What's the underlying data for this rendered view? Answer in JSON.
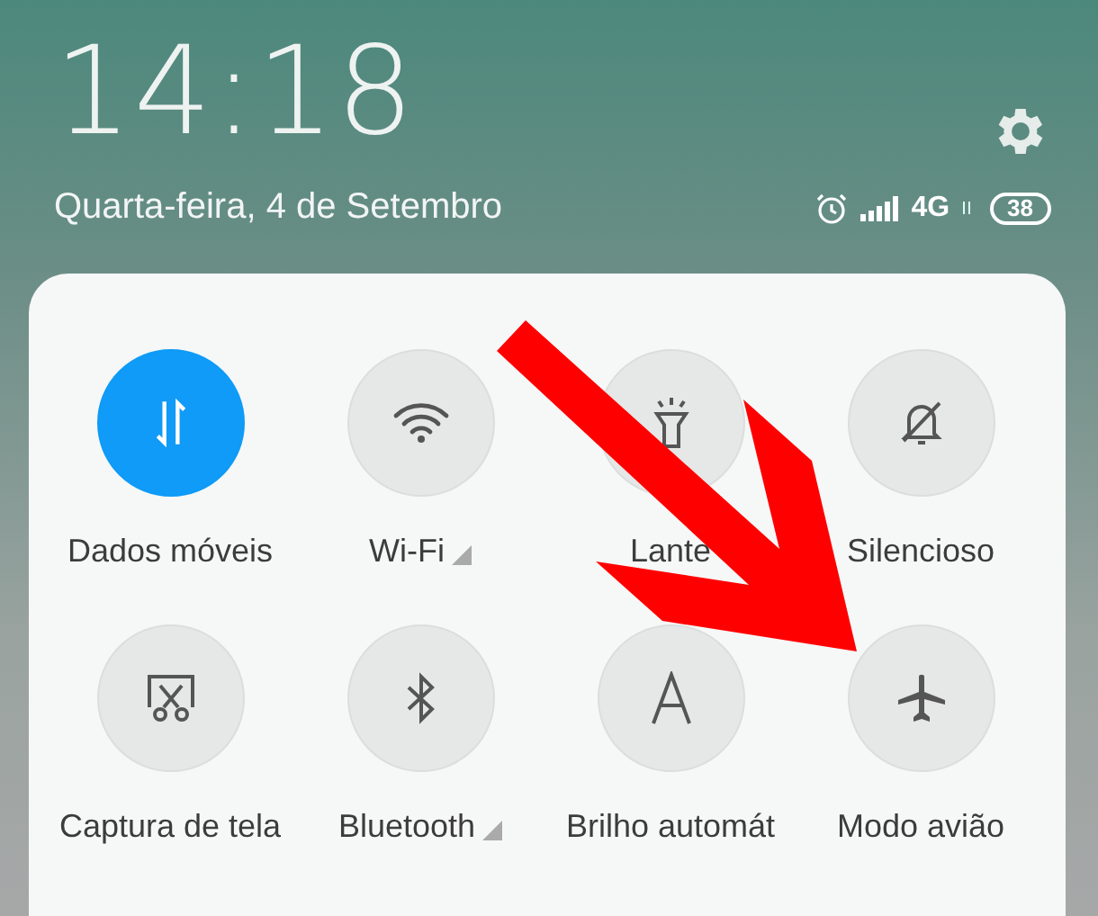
{
  "status": {
    "time": "14:18",
    "date": "Quarta-feira, 4 de Setembro",
    "network": "4G",
    "battery": "38"
  },
  "tiles": [
    {
      "label": "Dados móveis",
      "kind": "data",
      "on": true,
      "more": false
    },
    {
      "label": "Wi-Fi",
      "kind": "wifi",
      "on": false,
      "more": true
    },
    {
      "label": "Lante",
      "kind": "flashlight",
      "on": false,
      "more": false
    },
    {
      "label": "Silencioso",
      "kind": "silent",
      "on": false,
      "more": false
    },
    {
      "label": "Captura de tela",
      "kind": "screenshot",
      "on": false,
      "more": false
    },
    {
      "label": "Bluetooth",
      "kind": "bluetooth",
      "on": false,
      "more": true
    },
    {
      "label": "Brilho automát",
      "kind": "brightness",
      "on": false,
      "more": false
    },
    {
      "label": "Modo avião",
      "kind": "airplane",
      "on": false,
      "more": false
    }
  ]
}
